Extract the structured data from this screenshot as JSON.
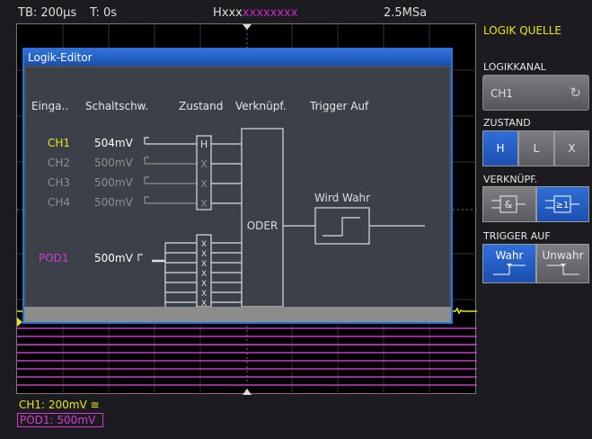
{
  "top": {
    "tb": "TB: 200µs",
    "t": "T: 0s",
    "hpre": "Hxxx",
    "hmag": "xxxxxxxx",
    "rate": "2.5MSa"
  },
  "panel": {
    "title": "LOGIK QUELLE",
    "logikkanal_label": "LOGIKKANAL",
    "logikkanal_value": "CH1",
    "zustand_label": "ZUSTAND",
    "zustand_options": [
      "H",
      "L",
      "X"
    ],
    "zustand_selected": "H",
    "verknupf_label": "VERKNÜPF.",
    "verknupf_selected": "≥1",
    "trigger_label": "TRIGGER AUF",
    "trigger_wahr": "Wahr",
    "trigger_unwahr": "Unwahr",
    "trigger_selected": "Wahr"
  },
  "dialog": {
    "title": "Logik-Editor",
    "headers": {
      "eingang": "Einga..",
      "schalt": "Schaltschw.",
      "zustand": "Zustand",
      "verknupf": "Verknüpf.",
      "trigger": "Trigger Auf"
    },
    "channels": [
      {
        "name": "CH1",
        "threshold": "504mV",
        "state": "H",
        "active": true
      },
      {
        "name": "CH2",
        "threshold": "500mV",
        "state": "X",
        "active": false
      },
      {
        "name": "CH3",
        "threshold": "500mV",
        "state": "X",
        "active": false
      },
      {
        "name": "CH4",
        "threshold": "500mV",
        "state": "X",
        "active": false
      }
    ],
    "pod": {
      "name": "POD1",
      "threshold": "500mV"
    },
    "gate": "ODER",
    "trigger_text": "Wird Wahr"
  },
  "bottom": {
    "ch1": "CH1: 200mV ≅",
    "pod1": "POD1: 500mV"
  },
  "colors": {
    "ch1": "#e6e61e",
    "pod": "#d23cd2",
    "accent": "#2a6fd6",
    "hmag": "#c828c8"
  }
}
